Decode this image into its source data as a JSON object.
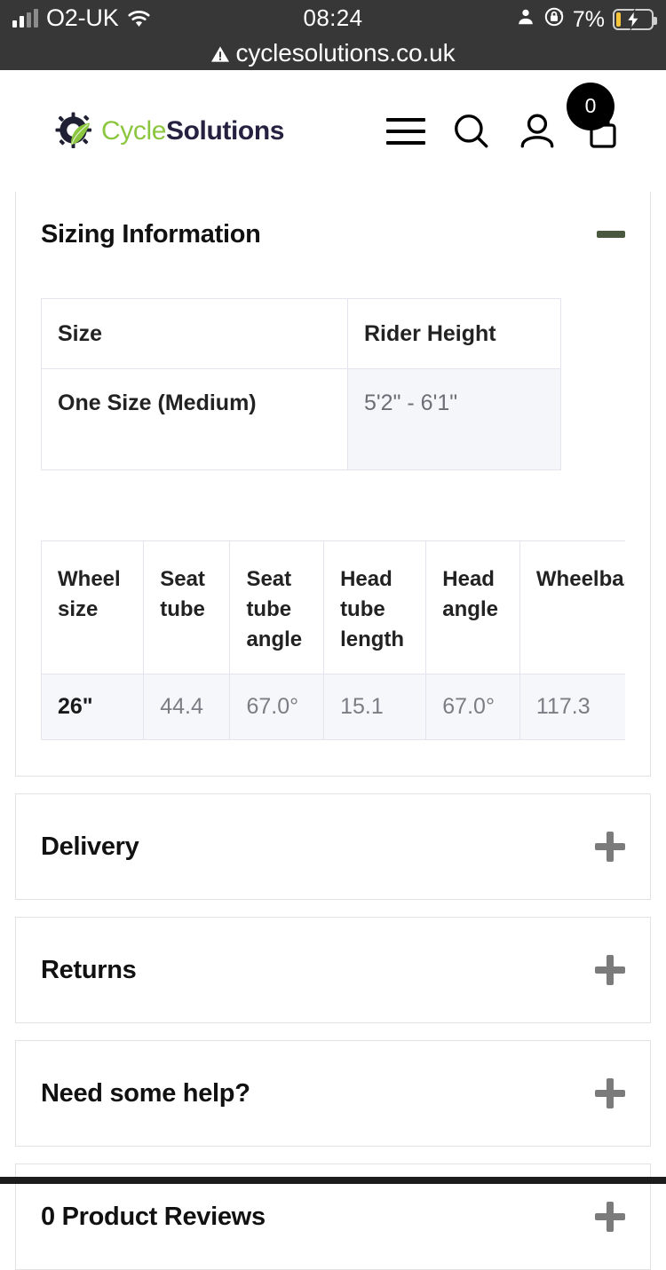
{
  "status_bar": {
    "carrier": "O2-UK",
    "time": "08:24",
    "battery_percent": "7%",
    "icons": {
      "signal": "signal-bars-icon",
      "wifi": "wifi-icon",
      "person": "person-icon",
      "rotation_lock": "rotation-lock-icon",
      "battery": "battery-charging-icon"
    }
  },
  "browser_bar": {
    "url": "cyclesolutions.co.uk",
    "security_icon": "not-secure-warning-icon"
  },
  "header": {
    "logo": {
      "mark": "cog-leaf-icon",
      "word1": "Cycle",
      "word2": "Solutions"
    },
    "menu_icon": "hamburger-menu-icon",
    "search_icon": "search-icon",
    "account_icon": "account-person-icon",
    "cart_icon": "shopping-bag-icon",
    "cart_count": "0"
  },
  "colors": {
    "logo_green": "#8cc63f",
    "logo_navy": "#262140",
    "minus_olive": "#4a5840",
    "plus_grey": "#7b7b7b",
    "table_border": "#e4e4ef",
    "table_cell_bg": "#f4f6fa",
    "status_bar_bg": "#373737"
  },
  "sizing_section": {
    "title": "Sizing Information",
    "toggle_icon": "minus-icon",
    "expanded": true,
    "size_table": {
      "headers": [
        "Size",
        "Rider Height"
      ],
      "rows": [
        [
          "One Size (Medium)",
          "5'2\" - 6'1\""
        ]
      ]
    },
    "geometry_table": {
      "headers": [
        "Wheel size",
        "Seat tube",
        "Seat tube angle",
        "Head tube length",
        "Head angle",
        "Wheelbase"
      ],
      "rows": [
        [
          "26\"",
          "44.4",
          "67.0°",
          "15.1",
          "67.0°",
          "117.3"
        ]
      ]
    }
  },
  "accordions": [
    {
      "title": "Delivery",
      "toggle_icon": "plus-icon",
      "expanded": false
    },
    {
      "title": "Returns",
      "toggle_icon": "plus-icon",
      "expanded": false
    },
    {
      "title": "Need some help?",
      "toggle_icon": "plus-icon",
      "expanded": false
    },
    {
      "title": "0 Product Reviews",
      "toggle_icon": "plus-icon",
      "expanded": false
    }
  ]
}
